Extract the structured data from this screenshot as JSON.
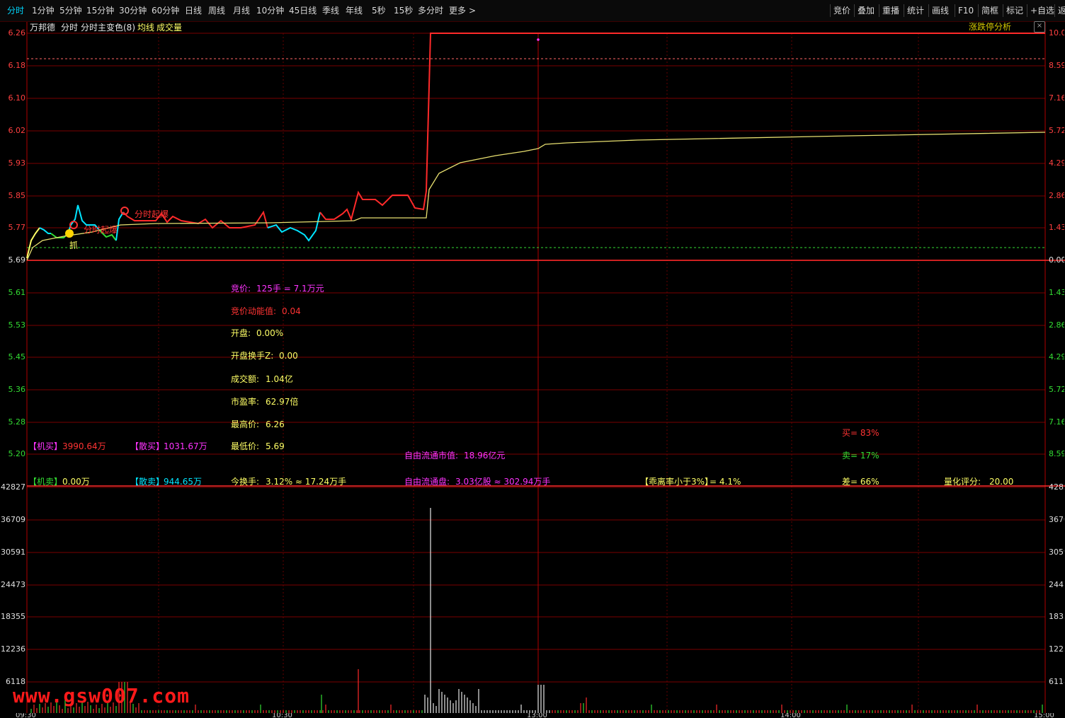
{
  "toolbar": {
    "periods": [
      "分时",
      "1分钟",
      "5分钟",
      "15分钟",
      "30分钟",
      "60分钟",
      "日线",
      "周线",
      "月线",
      "10分钟",
      "45日线",
      "季线",
      "年线",
      "5秒",
      "15秒",
      "多分时",
      "更多"
    ],
    "more_arrow": ">",
    "right_items": [
      "竞价",
      "叠加",
      "重播",
      "统计",
      "画线",
      "F10",
      "简框",
      "标记",
      "+自选",
      "返"
    ]
  },
  "header": {
    "stock_name": "万邦德",
    "mode": "分时",
    "indicator": "分时主变色(8)",
    "avg_line": "均线",
    "volume": "成交量",
    "analysis_button": "涨跌停分析",
    "close_icon": "×"
  },
  "price_axis_left": [
    "6.26",
    "6.18",
    "6.10",
    "6.02",
    "5.93",
    "5.85",
    "5.77",
    "5.69",
    "5.61",
    "5.53",
    "5.45",
    "5.36",
    "5.28",
    "5.20"
  ],
  "price_axis_right": [
    "10.0",
    "8.59",
    "7.16",
    "5.72",
    "4.29",
    "2.86",
    "1.43",
    "0.00",
    "1.43",
    "2.86",
    "4.29",
    "5.72",
    "7.16",
    "8.59"
  ],
  "volume_axis_left": [
    "42827",
    "36709",
    "30591",
    "24473",
    "18355",
    "12236",
    "6118"
  ],
  "volume_axis_right": [
    "42827",
    "36709",
    "30591",
    "24473",
    "18355",
    "12236",
    "6118"
  ],
  "time_axis": [
    "09:30",
    "10:30",
    "13:00",
    "14:00",
    "15:00"
  ],
  "markers": {
    "label1": "分时起爆",
    "label2": "分时起爆",
    "grab": "抓"
  },
  "stats": {
    "auction_label": "竞价:",
    "auction_value": "125手 = 7.1万元",
    "auction_momentum_label": "竞价动能值:",
    "auction_momentum_value": "0.04",
    "open_label": "开盘:",
    "open_value": "0.00%",
    "open_turnover_label": "开盘换手Z:",
    "open_turnover_value": "0.00",
    "amount_label": "成交额:",
    "amount_value": "1.04亿",
    "pe_label": "市盈率:",
    "pe_value": "62.97倍",
    "high_label": "最高价:",
    "high_value": "6.26",
    "low_label": "最低价:",
    "low_value": "5.69"
  },
  "flows": {
    "inst_buy_label": "【机买】",
    "inst_buy_value": "3990.64万",
    "retail_buy_label": "【散买】",
    "retail_buy_value": "1031.67万",
    "inst_sell_label": "【机卖】",
    "inst_sell_value": "0.00万",
    "retail_sell_label": "【散卖】",
    "retail_sell_value": "944.65万",
    "turnover_label": "今换手:",
    "turnover_value": "3.12% ≈ 17.24万手",
    "float_cap_label": "自由流通市值:",
    "float_cap_value": "18.96亿元",
    "float_shares_label": "自由流通盘:",
    "float_shares_value": "3.03亿股 ≈ 302.94万手",
    "deviation_label": "【乖离率小于3%】",
    "deviation_value": "= 4.1%",
    "buy_ratio": "买= 83%",
    "sell_ratio": "卖= 17%",
    "diff_ratio": "差= 66%",
    "score_label": "量化评分:",
    "score_value": "20.00"
  },
  "watermark": "www.gsw007.com",
  "colors": {
    "up": "#ff2a2a",
    "down": "#00e5ff",
    "avg": "#e8e070",
    "grid": "#7a0000",
    "magenta": "#ff33ff",
    "yellow": "#ffff66",
    "green": "#33dd33"
  }
}
